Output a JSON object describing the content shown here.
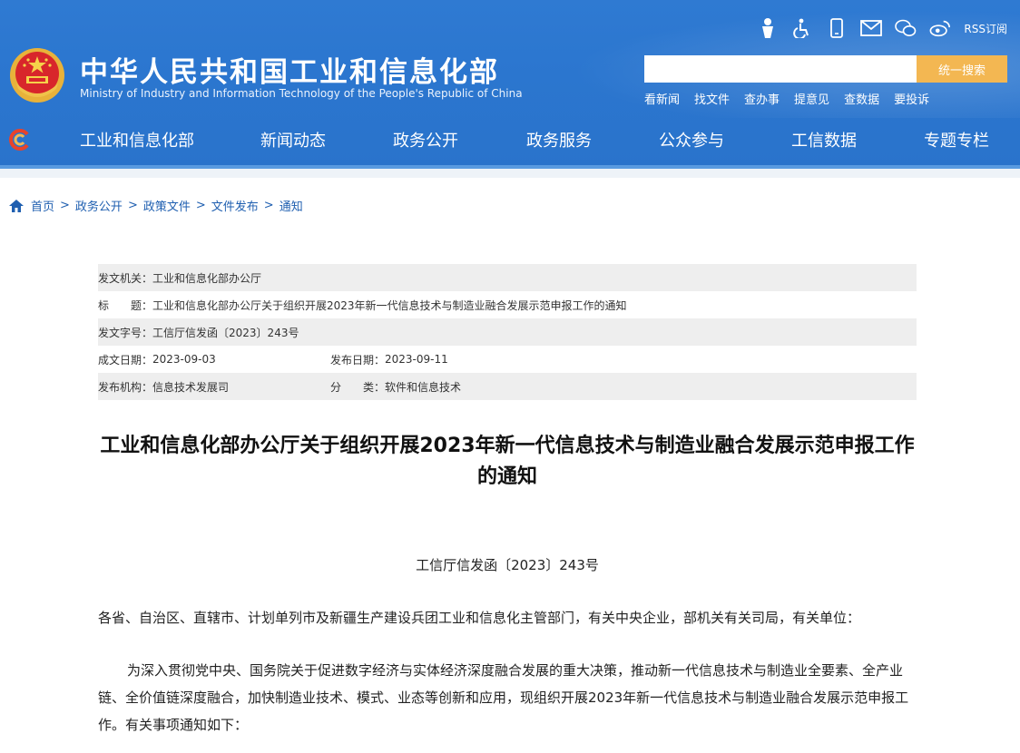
{
  "header": {
    "title": "中华人民共和国工业和信息化部",
    "subtitle": "Ministry of Industry and Information Technology of the People's Republic of China",
    "toolbar_rss": "RSS订阅",
    "search_placeholder": "",
    "search_button": "统一搜索",
    "quick_links": [
      "看新闻",
      "找文件",
      "查办事",
      "提意见",
      "查数据",
      "要投诉"
    ],
    "nav": [
      "工业和信息化部",
      "新闻动态",
      "政务公开",
      "政务服务",
      "公众参与",
      "工信数据",
      "专题专栏"
    ],
    "colors": {
      "header_blue": "#2b76cf",
      "search_btn": "#f3b752",
      "link_blue": "#1f5fb0"
    }
  },
  "breadcrumb": [
    "首页",
    "政务公开",
    "政策文件",
    "文件发布",
    "通知"
  ],
  "info": {
    "issuer_label": "发文机关：",
    "issuer": "工业和信息化部办公厅",
    "title_label": "标　　题：",
    "title": "工业和信息化部办公厅关于组织开展2023年新一代信息技术与制造业融合发展示范申报工作的通知",
    "docno_label": "发文字号：",
    "docno": "工信厅信发函〔2023〕243号",
    "date_label": "成文日期：",
    "date": "2023-09-03",
    "pubdate_label": "发布日期：",
    "pubdate": "2023-09-11",
    "org_label": "发布机构：",
    "org": "信息技术发展司",
    "category_label": "分　　类：",
    "category": "软件和信息技术"
  },
  "article": {
    "title": "工业和信息化部办公厅关于组织开展2023年新一代信息技术与制造业融合发展示范申报工作的通知",
    "doc_number": "工信厅信发函〔2023〕243号",
    "addressee": "各省、自治区、直辖市、计划单列市及新疆生产建设兵团工业和信息化主管部门，有关中央企业，部机关有关司局，有关单位：",
    "paragraph1": "为深入贯彻党中央、国务院关于促进数字经济与实体经济深度融合发展的重大决策，推动新一代信息技术与制造业全要素、全产业链、全价值链深度融合，加快制造业技术、模式、业态等创新和应用，现组织开展2023年新一代信息技术与制造业融合发展示范申报工作。有关事项通知如下："
  }
}
